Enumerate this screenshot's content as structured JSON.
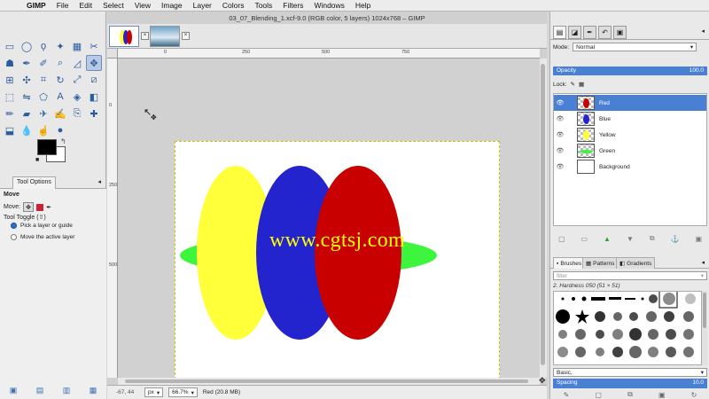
{
  "menubar": {
    "app": "GIMP",
    "items": [
      "File",
      "Edit",
      "Select",
      "View",
      "Image",
      "Layer",
      "Colors",
      "Tools",
      "Filters",
      "Windows",
      "Help"
    ]
  },
  "image_window": {
    "title": "03_07_Blending_1.xcf-9.0 (RGB color, 5 layers) 1024x768 – GIMP",
    "ruler_h": [
      "0",
      "250",
      "500",
      "750"
    ],
    "ruler_v": [
      "0",
      "250",
      "500"
    ],
    "watermark": "www.cgtsj.com",
    "status": {
      "coords": "-67, 44",
      "unit": "px",
      "zoom": "66.7%",
      "info": "Red (20.8 MB)"
    }
  },
  "toolbox": {
    "tool_options_tab": "Tool Options",
    "tool_title": "Move",
    "move_label": "Move:",
    "tool_toggle": "Tool Toggle  (⇧)",
    "radio_1": "Pick a layer or guide",
    "radio_2": "Move the active layer"
  },
  "layers_panel": {
    "mode_label": "Mode:",
    "mode_value": "Normal",
    "opacity_label": "Opacity",
    "opacity_value": "100.0",
    "lock_label": "Lock:",
    "layers": [
      {
        "name": "Red",
        "color": "#c80000"
      },
      {
        "name": "Blue",
        "color": "#2424cf"
      },
      {
        "name": "Yellow",
        "color": "#ffff3a"
      },
      {
        "name": "Green",
        "color": "#3ef53e"
      },
      {
        "name": "Background",
        "color": "#ffffff"
      }
    ],
    "selected": "Red"
  },
  "brushes_panel": {
    "tabs": [
      "Brushes",
      "Patterns",
      "Gradients"
    ],
    "filter_placeholder": "filter",
    "brush_name": "2. Hardness 050 (51 × 51)",
    "preset": "Basic,",
    "spacing_label": "Spacing",
    "spacing_value": "10.0"
  },
  "colors": {
    "foreground": "#000000",
    "background": "#ffffff"
  }
}
